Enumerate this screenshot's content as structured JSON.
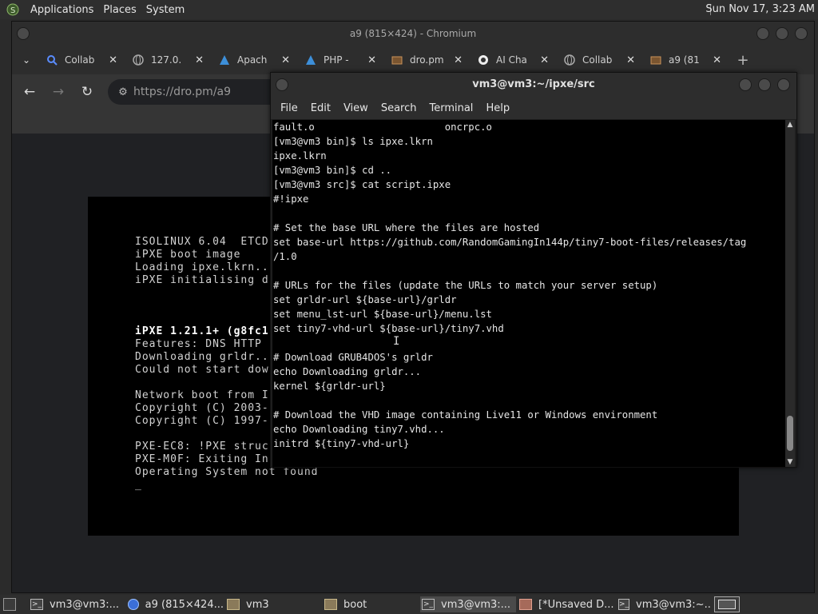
{
  "top_panel": {
    "menus": [
      "Applications",
      "Places",
      "System"
    ],
    "clock": "Sun Nov 17,  3:23 AM"
  },
  "chromium": {
    "window_title": "a9 (815×424) - Chromium",
    "tabs": [
      {
        "label": "Collab",
        "icon": "search-icon"
      },
      {
        "label": "127.0.",
        "icon": "globe-icon"
      },
      {
        "label": "Apach",
        "icon": "arch-icon"
      },
      {
        "label": "PHP - ",
        "icon": "arch-icon"
      },
      {
        "label": "dro.pm",
        "icon": "image-icon"
      },
      {
        "label": "AI Cha",
        "icon": "openai-icon"
      },
      {
        "label": "Collab",
        "icon": "globe-icon"
      },
      {
        "label": "a9 (81",
        "icon": "image-icon"
      }
    ],
    "url": {
      "host": "https://dro.pm",
      "path": "/a9"
    }
  },
  "boot_screen": {
    "lines": [
      {
        "text": "ISOLINUX 6.04  ETCD",
        "bold": false
      },
      {
        "text": "iPXE boot image",
        "bold": false
      },
      {
        "text": "Loading ipxe.lkrn..",
        "bold": false
      },
      {
        "text": "iPXE initialising d",
        "bold": false
      },
      {
        "text": "iPXE 1.21.1+ (g8fc1",
        "bold": true
      },
      {
        "text": "Features: DNS HTTP",
        "bold": false
      },
      {
        "text": "Downloading grldr..",
        "bold": false
      },
      {
        "text": "Could not start dow",
        "bold": false
      },
      {
        "text": "Network boot from I",
        "bold": false
      },
      {
        "text": "Copyright (C) 2003-",
        "bold": false
      },
      {
        "text": "Copyright (C) 1997-",
        "bold": false
      },
      {
        "text": "PXE-EC8: !PXE struc",
        "bold": false
      },
      {
        "text": "PXE-M0F: Exiting In",
        "bold": false
      },
      {
        "text": "Operating System not found",
        "bold": false
      },
      {
        "text": "_",
        "bold": false
      }
    ]
  },
  "terminal": {
    "title": "vm3@vm3:~/ipxe/src",
    "menus": [
      "File",
      "Edit",
      "View",
      "Search",
      "Terminal",
      "Help"
    ],
    "lines": [
      "fault.o                      oncrpc.o",
      "[vm3@vm3 bin]$ ls ipxe.lkrn",
      "ipxe.lkrn",
      "[vm3@vm3 bin]$ cd ..",
      "[vm3@vm3 src]$ cat script.ipxe",
      "#!ipxe",
      "",
      "# Set the base URL where the files are hosted",
      "set base-url https://github.com/RandomGamingIn144p/tiny7-boot-files/releases/tag",
      "/1.0",
      "",
      "# URLs for the files (update the URLs to match your server setup)",
      "set grldr-url ${base-url}/grldr",
      "set menu_lst-url ${base-url}/menu.lst",
      "set tiny7-vhd-url ${base-url}/tiny7.vhd",
      "",
      "# Download GRUB4DOS's grldr",
      "echo Downloading grldr...",
      "kernel ${grldr-url}",
      "",
      "# Download the VHD image containing Live11 or Windows environment",
      "echo Downloading tiny7.vhd...",
      "initrd ${tiny7-vhd-url}"
    ]
  },
  "taskbar": {
    "items": [
      {
        "label": "vm3@vm3:...",
        "icon": "terminal-icon"
      },
      {
        "label": "a9 (815×424...",
        "icon": "chromium-icon"
      },
      {
        "label": "vm3",
        "icon": "folder-icon"
      },
      {
        "label": "boot",
        "icon": "folder-icon"
      },
      {
        "label": "vm3@vm3:...",
        "icon": "terminal-icon"
      },
      {
        "label": "[*Unsaved D...",
        "icon": "text-editor-icon"
      },
      {
        "label": "vm3@vm3:~...",
        "icon": "terminal-icon"
      }
    ]
  }
}
